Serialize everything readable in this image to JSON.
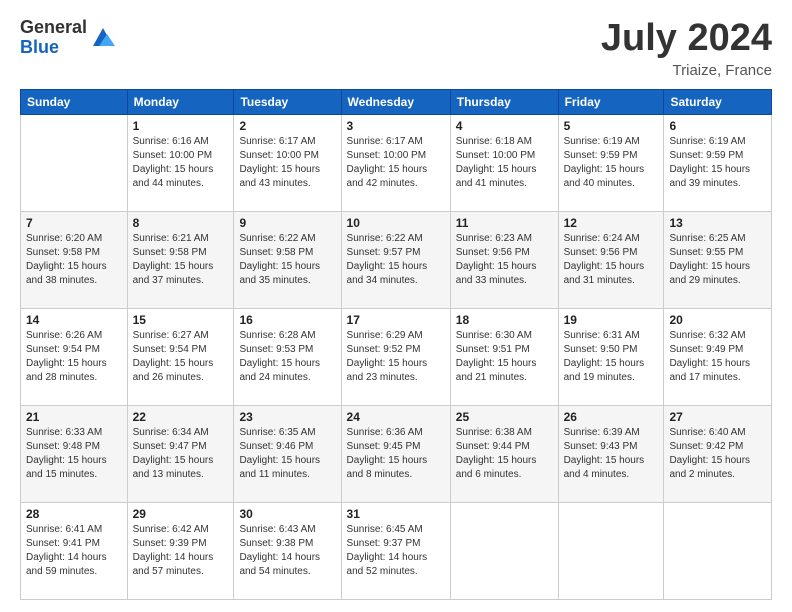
{
  "header": {
    "logo_general": "General",
    "logo_blue": "Blue",
    "month_year": "July 2024",
    "location": "Triaize, France"
  },
  "calendar": {
    "headers": [
      "Sunday",
      "Monday",
      "Tuesday",
      "Wednesday",
      "Thursday",
      "Friday",
      "Saturday"
    ],
    "weeks": [
      {
        "days": [
          {
            "num": "",
            "info": ""
          },
          {
            "num": "1",
            "info": "Sunrise: 6:16 AM\nSunset: 10:00 PM\nDaylight: 15 hours\nand 44 minutes."
          },
          {
            "num": "2",
            "info": "Sunrise: 6:17 AM\nSunset: 10:00 PM\nDaylight: 15 hours\nand 43 minutes."
          },
          {
            "num": "3",
            "info": "Sunrise: 6:17 AM\nSunset: 10:00 PM\nDaylight: 15 hours\nand 42 minutes."
          },
          {
            "num": "4",
            "info": "Sunrise: 6:18 AM\nSunset: 10:00 PM\nDaylight: 15 hours\nand 41 minutes."
          },
          {
            "num": "5",
            "info": "Sunrise: 6:19 AM\nSunset: 9:59 PM\nDaylight: 15 hours\nand 40 minutes."
          },
          {
            "num": "6",
            "info": "Sunrise: 6:19 AM\nSunset: 9:59 PM\nDaylight: 15 hours\nand 39 minutes."
          }
        ]
      },
      {
        "days": [
          {
            "num": "7",
            "info": "Sunrise: 6:20 AM\nSunset: 9:58 PM\nDaylight: 15 hours\nand 38 minutes."
          },
          {
            "num": "8",
            "info": "Sunrise: 6:21 AM\nSunset: 9:58 PM\nDaylight: 15 hours\nand 37 minutes."
          },
          {
            "num": "9",
            "info": "Sunrise: 6:22 AM\nSunset: 9:58 PM\nDaylight: 15 hours\nand 35 minutes."
          },
          {
            "num": "10",
            "info": "Sunrise: 6:22 AM\nSunset: 9:57 PM\nDaylight: 15 hours\nand 34 minutes."
          },
          {
            "num": "11",
            "info": "Sunrise: 6:23 AM\nSunset: 9:56 PM\nDaylight: 15 hours\nand 33 minutes."
          },
          {
            "num": "12",
            "info": "Sunrise: 6:24 AM\nSunset: 9:56 PM\nDaylight: 15 hours\nand 31 minutes."
          },
          {
            "num": "13",
            "info": "Sunrise: 6:25 AM\nSunset: 9:55 PM\nDaylight: 15 hours\nand 29 minutes."
          }
        ]
      },
      {
        "days": [
          {
            "num": "14",
            "info": "Sunrise: 6:26 AM\nSunset: 9:54 PM\nDaylight: 15 hours\nand 28 minutes."
          },
          {
            "num": "15",
            "info": "Sunrise: 6:27 AM\nSunset: 9:54 PM\nDaylight: 15 hours\nand 26 minutes."
          },
          {
            "num": "16",
            "info": "Sunrise: 6:28 AM\nSunset: 9:53 PM\nDaylight: 15 hours\nand 24 minutes."
          },
          {
            "num": "17",
            "info": "Sunrise: 6:29 AM\nSunset: 9:52 PM\nDaylight: 15 hours\nand 23 minutes."
          },
          {
            "num": "18",
            "info": "Sunrise: 6:30 AM\nSunset: 9:51 PM\nDaylight: 15 hours\nand 21 minutes."
          },
          {
            "num": "19",
            "info": "Sunrise: 6:31 AM\nSunset: 9:50 PM\nDaylight: 15 hours\nand 19 minutes."
          },
          {
            "num": "20",
            "info": "Sunrise: 6:32 AM\nSunset: 9:49 PM\nDaylight: 15 hours\nand 17 minutes."
          }
        ]
      },
      {
        "days": [
          {
            "num": "21",
            "info": "Sunrise: 6:33 AM\nSunset: 9:48 PM\nDaylight: 15 hours\nand 15 minutes."
          },
          {
            "num": "22",
            "info": "Sunrise: 6:34 AM\nSunset: 9:47 PM\nDaylight: 15 hours\nand 13 minutes."
          },
          {
            "num": "23",
            "info": "Sunrise: 6:35 AM\nSunset: 9:46 PM\nDaylight: 15 hours\nand 11 minutes."
          },
          {
            "num": "24",
            "info": "Sunrise: 6:36 AM\nSunset: 9:45 PM\nDaylight: 15 hours\nand 8 minutes."
          },
          {
            "num": "25",
            "info": "Sunrise: 6:38 AM\nSunset: 9:44 PM\nDaylight: 15 hours\nand 6 minutes."
          },
          {
            "num": "26",
            "info": "Sunrise: 6:39 AM\nSunset: 9:43 PM\nDaylight: 15 hours\nand 4 minutes."
          },
          {
            "num": "27",
            "info": "Sunrise: 6:40 AM\nSunset: 9:42 PM\nDaylight: 15 hours\nand 2 minutes."
          }
        ]
      },
      {
        "days": [
          {
            "num": "28",
            "info": "Sunrise: 6:41 AM\nSunset: 9:41 PM\nDaylight: 14 hours\nand 59 minutes."
          },
          {
            "num": "29",
            "info": "Sunrise: 6:42 AM\nSunset: 9:39 PM\nDaylight: 14 hours\nand 57 minutes."
          },
          {
            "num": "30",
            "info": "Sunrise: 6:43 AM\nSunset: 9:38 PM\nDaylight: 14 hours\nand 54 minutes."
          },
          {
            "num": "31",
            "info": "Sunrise: 6:45 AM\nSunset: 9:37 PM\nDaylight: 14 hours\nand 52 minutes."
          },
          {
            "num": "",
            "info": ""
          },
          {
            "num": "",
            "info": ""
          },
          {
            "num": "",
            "info": ""
          }
        ]
      }
    ]
  }
}
